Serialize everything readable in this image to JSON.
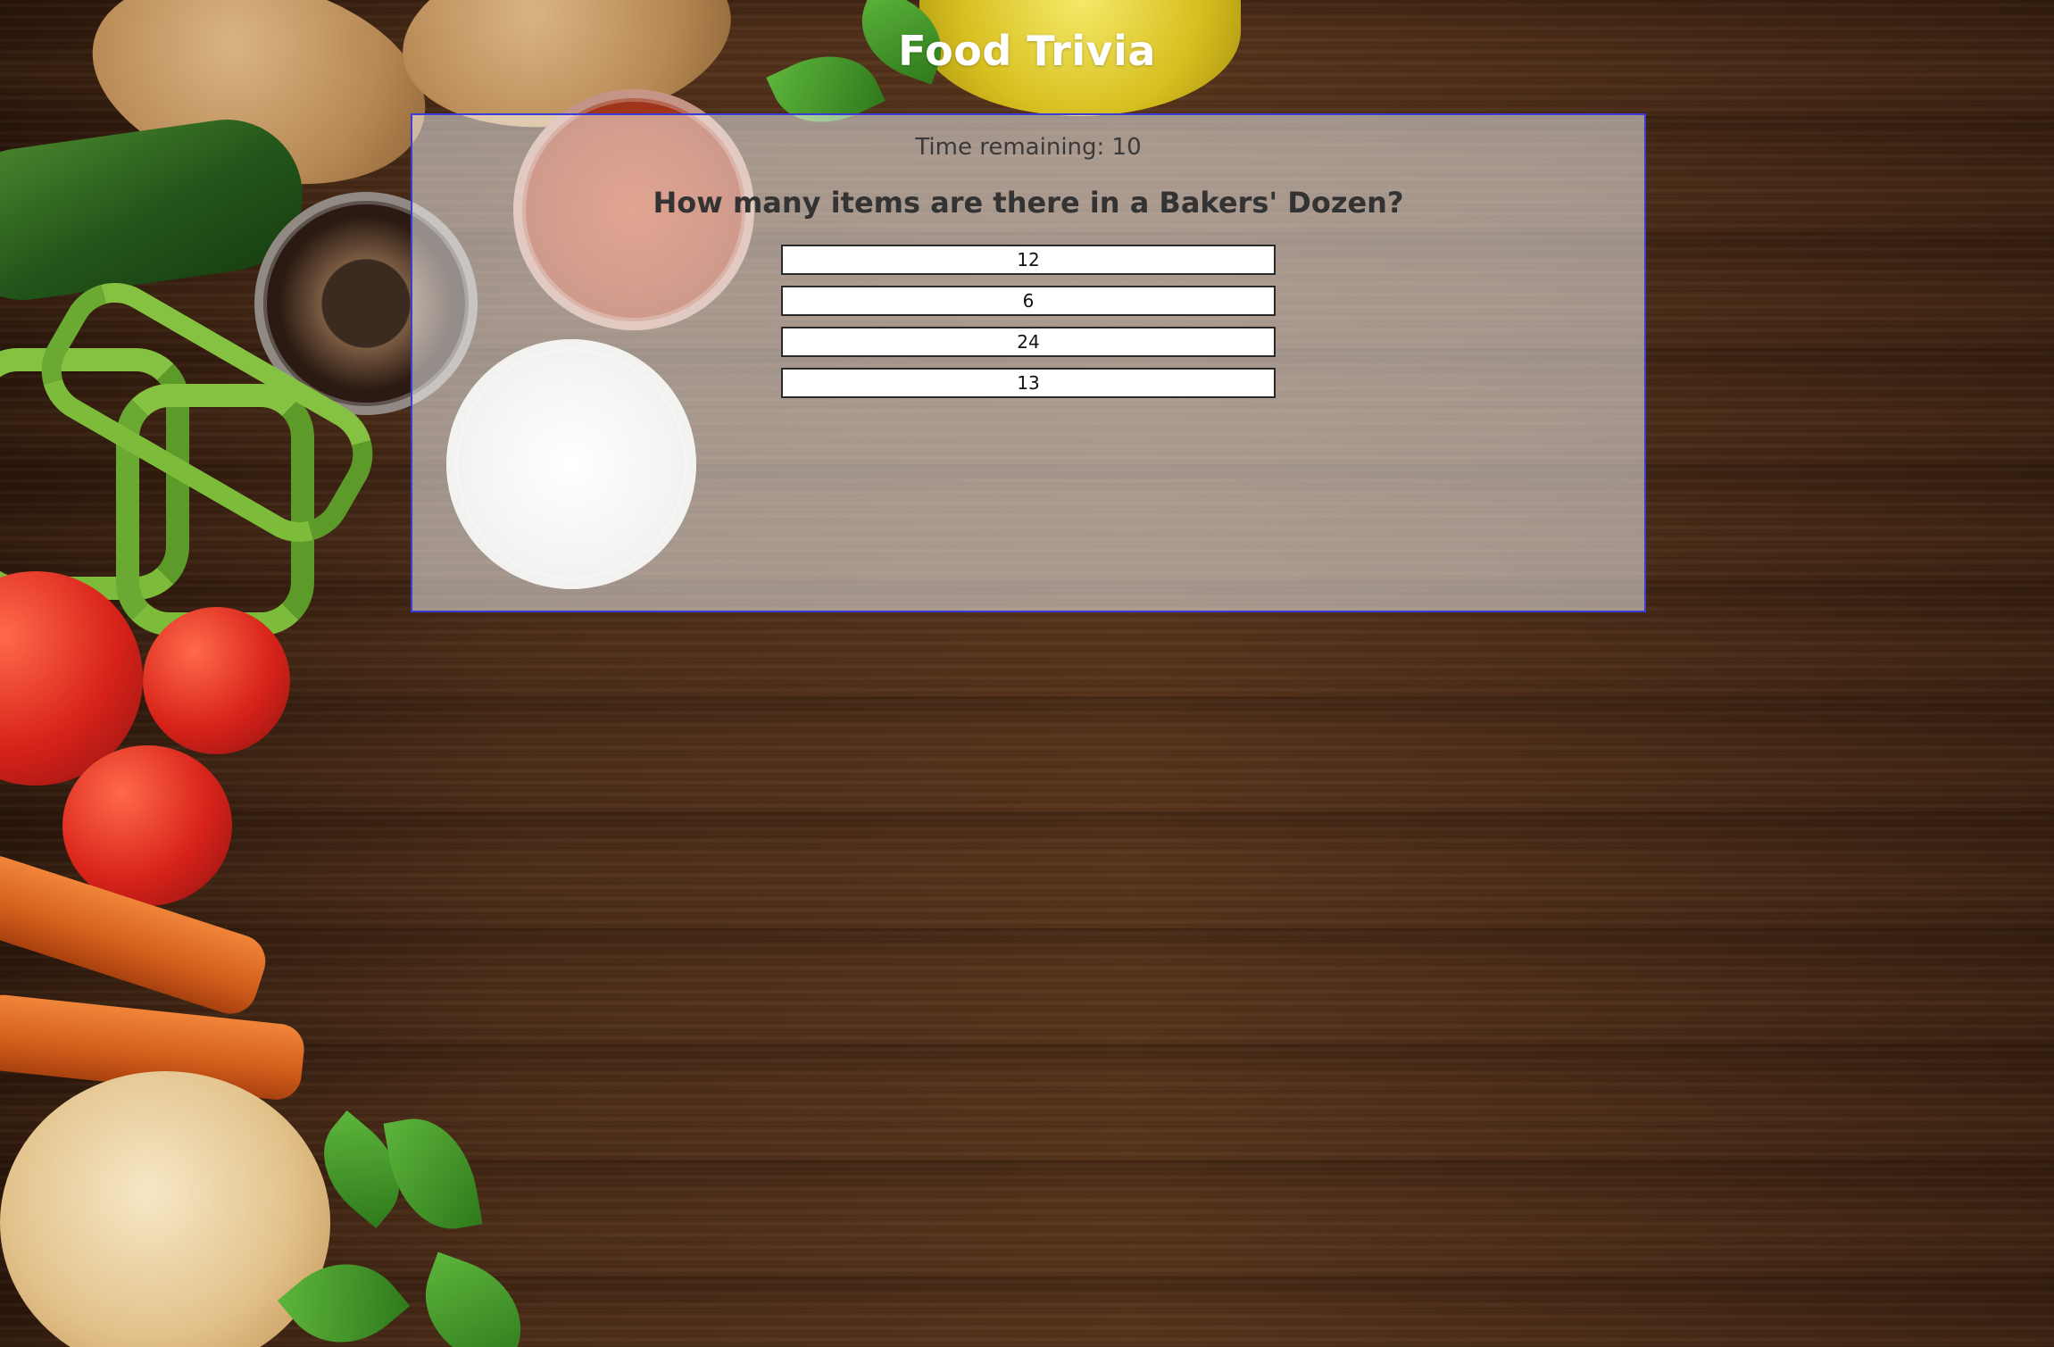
{
  "app": {
    "title": "Food Trivia"
  },
  "quiz": {
    "timer_text": "Time remaining: 10",
    "question": "How many items are there in a Bakers' Dozen?",
    "answers": [
      "12",
      "6",
      "24",
      "13"
    ]
  },
  "colors": {
    "panel_border": "#3b3bd6",
    "title_text": "#ffffff"
  },
  "background": {
    "description_icons": [
      "potato-icon",
      "spice-jar-icon",
      "cucumber-icon",
      "green-bean-icon",
      "tomato-icon",
      "carrot-icon",
      "onion-icon",
      "basil-leaf-icon",
      "olive-oil-icon"
    ]
  }
}
